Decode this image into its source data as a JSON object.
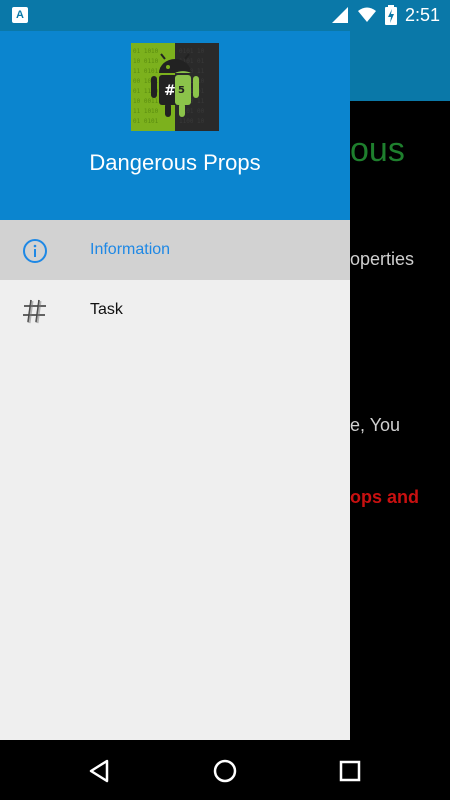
{
  "status": {
    "time": "2:51",
    "notification_letter": "A",
    "battery_level_percent": 60
  },
  "drawer": {
    "app_title": "Dangerous Props",
    "items": [
      {
        "label": "Information",
        "icon": "info-icon",
        "active": true
      },
      {
        "label": "Task",
        "icon": "hash-icon",
        "active": false
      }
    ]
  },
  "background": {
    "title_fragment": "ous",
    "line1": "operties",
    "line2": "e, You",
    "line3": "ops and"
  },
  "colors": {
    "status_bar": "#0a78a8",
    "header": "#0b85cf",
    "active_text": "#1e88e5",
    "drawer_bg": "#efefef"
  },
  "nav": {
    "back_icon": "back-icon",
    "home_icon": "home-icon",
    "recents_icon": "recents-icon"
  }
}
